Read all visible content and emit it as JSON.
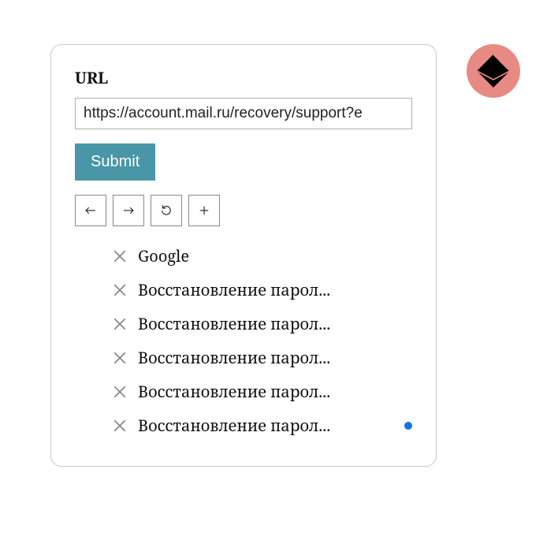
{
  "logo_icon": "envelope-diamond",
  "card": {
    "url_label": "URL",
    "url_value": "https://account.mail.ru/recovery/support?e",
    "submit_label": "Submit"
  },
  "nav": {
    "back_icon": "arrow-left",
    "forward_icon": "arrow-right",
    "refresh_icon": "refresh",
    "add_icon": "plus"
  },
  "tabs": [
    {
      "title": "Google",
      "active": false
    },
    {
      "title": "Восстановление парол...",
      "active": false
    },
    {
      "title": "Восстановление парол...",
      "active": false
    },
    {
      "title": "Восстановление парол...",
      "active": false
    },
    {
      "title": "Восстановление парол...",
      "active": false
    },
    {
      "title": "Восстановление парол...",
      "active": true
    }
  ],
  "colors": {
    "logo_bg": "#e88a84",
    "submit_bg": "#4896a8",
    "active_dot": "#1571e6"
  }
}
